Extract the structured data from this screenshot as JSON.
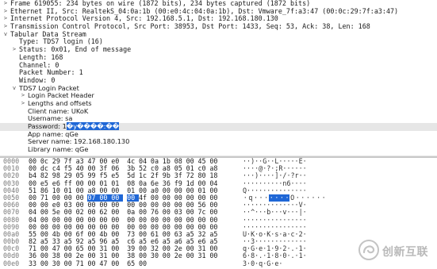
{
  "tree": [
    {
      "indent": 0,
      "toggle": ">",
      "text": "Frame 619055: 234 bytes on wire (1872 bits), 234 bytes captured (1872 bits)",
      "font": "mono"
    },
    {
      "indent": 0,
      "toggle": ">",
      "text": "Ethernet II, Src: RealtekS_04:0a:1b (00:e0:4c:04:0a:1b), Dst: Vmware_7f:a3:47 (00:0c:29:7f:a3:47)",
      "font": "mono"
    },
    {
      "indent": 0,
      "toggle": ">",
      "text": "Internet Protocol Version 4, Src: 192.168.5.1, Dst: 192.168.180.130",
      "font": "mono"
    },
    {
      "indent": 0,
      "toggle": ">",
      "text": "Transmission Control Protocol, Src Port: 38953, Dst Port: 1433, Seq: 53, Ack: 38, Len: 168",
      "font": "mono"
    },
    {
      "indent": 0,
      "toggle": "v",
      "text": "Tabular Data Stream",
      "font": "mono"
    },
    {
      "indent": 1,
      "toggle": "",
      "text": "Type: TDS7 login (16)",
      "font": "mono"
    },
    {
      "indent": 1,
      "toggle": ">",
      "text": "Status: 0x01, End of message",
      "font": "mono"
    },
    {
      "indent": 1,
      "toggle": "",
      "text": "Length: 168",
      "font": "mono"
    },
    {
      "indent": 1,
      "toggle": "",
      "text": "Channel: 0",
      "font": "mono"
    },
    {
      "indent": 1,
      "toggle": "",
      "text": "Packet Number: 1",
      "font": "mono"
    },
    {
      "indent": 1,
      "toggle": "",
      "text": "Window: 0",
      "font": "mono"
    },
    {
      "indent": 1,
      "toggle": "v",
      "text": "TDS7 Login Packet",
      "font": "sans"
    },
    {
      "indent": 2,
      "toggle": ">",
      "text": "Login Packet Header",
      "font": "sans"
    },
    {
      "indent": 2,
      "toggle": ">",
      "text": "Lengths and offsets",
      "font": "sans"
    },
    {
      "indent": 2,
      "toggle": "",
      "text": "Client name: UKoK",
      "font": "sans"
    },
    {
      "indent": 2,
      "toggle": "",
      "text": "Username: sa",
      "font": "sans"
    },
    {
      "indent": 2,
      "toggle": "",
      "text": "Password: 1",
      "font": "sans",
      "selected": true,
      "highlight": "�y����:��"
    },
    {
      "indent": 2,
      "toggle": "",
      "text": "App name: qGe",
      "font": "sans"
    },
    {
      "indent": 2,
      "toggle": "",
      "text": "Server name: 192.168.180.130",
      "font": "sans"
    },
    {
      "indent": 2,
      "toggle": "",
      "text": "Library name: qGe",
      "font": "sans"
    }
  ],
  "hex": [
    {
      "offset": "0000",
      "bytes": [
        "00",
        "0c",
        "29",
        "7f",
        "a3",
        "47",
        "00",
        "e0",
        "4c",
        "04",
        "0a",
        "1b",
        "08",
        "00",
        "45",
        "00"
      ],
      "ascii": "··)··G··L·····E·"
    },
    {
      "offset": "0010",
      "bytes": [
        "00",
        "dc",
        "c4",
        "f5",
        "40",
        "00",
        "3f",
        "06",
        "3b",
        "52",
        "c0",
        "a8",
        "05",
        "01",
        "c0",
        "a8"
      ],
      "ascii": "····@·?·;R······"
    },
    {
      "offset": "0020",
      "bytes": [
        "b4",
        "82",
        "98",
        "29",
        "05",
        "99",
        "f5",
        "e5",
        "5d",
        "1c",
        "2f",
        "9b",
        "3f",
        "72",
        "80",
        "18"
      ],
      "ascii": "···)····]·/·?r··"
    },
    {
      "offset": "0030",
      "bytes": [
        "00",
        "e5",
        "e6",
        "ff",
        "00",
        "00",
        "01",
        "01",
        "08",
        "0a",
        "6e",
        "36",
        "f9",
        "1d",
        "00",
        "04"
      ],
      "ascii": "··········n6····"
    },
    {
      "offset": "0040",
      "bytes": [
        "51",
        "86",
        "10",
        "01",
        "00",
        "a8",
        "00",
        "00",
        "01",
        "00",
        "a0",
        "00",
        "00",
        "00",
        "01",
        "00"
      ],
      "ascii": "Q···············"
    },
    {
      "offset": "0050",
      "bytes": [
        "00",
        "71",
        "00",
        "00",
        "00",
        "07",
        "00",
        "00",
        "00",
        "4f",
        "00",
        "00",
        "00",
        "00",
        "00",
        "00"
      ],
      "ascii": "·q·······O······",
      "sel": [
        5,
        6,
        7,
        8
      ]
    },
    {
      "offset": "0060",
      "bytes": [
        "00",
        "00",
        "e0",
        "03",
        "00",
        "00",
        "00",
        "00",
        "00",
        "00",
        "00",
        "00",
        "00",
        "00",
        "56",
        "00"
      ],
      "ascii": "··············V·"
    },
    {
      "offset": "0070",
      "bytes": [
        "04",
        "00",
        "5e",
        "00",
        "02",
        "00",
        "62",
        "00",
        "0a",
        "00",
        "76",
        "00",
        "03",
        "00",
        "7c",
        "00"
      ],
      "ascii": "··^···b···v···|·"
    },
    {
      "offset": "0080",
      "bytes": [
        "04",
        "00",
        "00",
        "00",
        "00",
        "00",
        "00",
        "00",
        "00",
        "00",
        "00",
        "00",
        "00",
        "00",
        "00",
        "00"
      ],
      "ascii": "················"
    },
    {
      "offset": "0090",
      "bytes": [
        "00",
        "00",
        "00",
        "00",
        "00",
        "00",
        "00",
        "00",
        "00",
        "00",
        "00",
        "00",
        "00",
        "00",
        "00",
        "00"
      ],
      "ascii": "················"
    },
    {
      "offset": "00a0",
      "bytes": [
        "55",
        "00",
        "4b",
        "00",
        "6f",
        "00",
        "4b",
        "00",
        "73",
        "00",
        "61",
        "00",
        "63",
        "a5",
        "32",
        "a5"
      ],
      "ascii": "U·K·o·K·s·a·c·2·"
    },
    {
      "offset": "00b0",
      "bytes": [
        "82",
        "a5",
        "33",
        "a5",
        "92",
        "a5",
        "96",
        "a5",
        "c6",
        "a5",
        "e6",
        "a5",
        "a6",
        "a5",
        "e6",
        "a5"
      ],
      "ascii": "··3·············"
    },
    {
      "offset": "00c0",
      "bytes": [
        "71",
        "00",
        "47",
        "00",
        "65",
        "00",
        "31",
        "00",
        "39",
        "00",
        "32",
        "00",
        "2e",
        "00",
        "31",
        "00"
      ],
      "ascii": "q·G·e·1·9·2·.·1·"
    },
    {
      "offset": "00d0",
      "bytes": [
        "36",
        "00",
        "38",
        "00",
        "2e",
        "00",
        "31",
        "00",
        "38",
        "00",
        "30",
        "00",
        "2e",
        "00",
        "31",
        "00"
      ],
      "ascii": "6·8·.·1·8·0·.·1·"
    },
    {
      "offset": "00e0",
      "bytes": [
        "33",
        "00",
        "30",
        "00",
        "71",
        "00",
        "47",
        "00",
        "65",
        "00"
      ],
      "ascii": "3·0·q·G·e·"
    }
  ],
  "watermark": {
    "text": "创新互联",
    "logo": "swirl-logo"
  },
  "colors": {
    "selection": "#1f67d6",
    "selected_row": "#e6e6e6",
    "offset": "#7a7a7a"
  }
}
